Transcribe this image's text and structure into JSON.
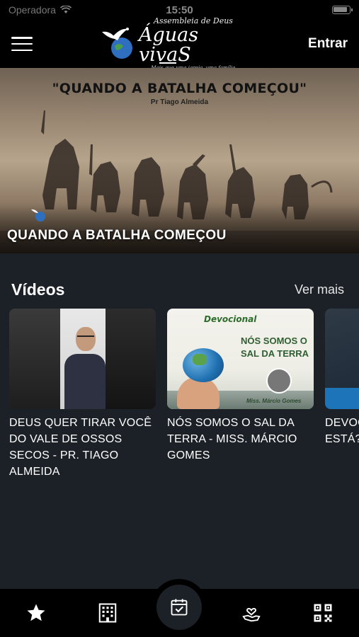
{
  "status_bar": {
    "carrier": "Operadora",
    "time": "15:50"
  },
  "header": {
    "logo": {
      "top_line": "Assembleia de Deus",
      "main": "Águas vivaS",
      "tagline": "Mais que uma igreja, uma família"
    },
    "login_label": "Entrar"
  },
  "banner": {
    "headline": "\"QUANDO A BATALHA COMEÇOU\"",
    "author": "Pr Tiago Almeida",
    "title": "QUANDO A BATALHA COMEÇOU"
  },
  "videos": {
    "section_title": "Vídeos",
    "see_more_label": "Ver mais",
    "items": [
      {
        "caption": "DEUS QUER TIRAR VOCÊ DO VALE DE OSSOS SECOS - PR. TIAGO ALMEIDA"
      },
      {
        "caption": "NÓS SOMOS O SAL DA TERRA - MISS. MÁRCIO GOMES",
        "thumb_header": "Devocional",
        "thumb_title_1": "NÓS SOMOS O",
        "thumb_title_2": "SAL DA TERRA",
        "thumb_signature": "Miss. Márcio Gomes"
      },
      {
        "caption": "DEVOCIONAL QUAL ESTÁ? ALMEIDA"
      }
    ]
  },
  "tab_bar": {
    "tabs": [
      {
        "icon": "star-icon"
      },
      {
        "icon": "building-icon"
      },
      {
        "icon": "calendar-check-icon"
      },
      {
        "icon": "hand-heart-icon"
      },
      {
        "icon": "qr-code-icon"
      }
    ]
  },
  "colors": {
    "background": "#1c2127",
    "bar": "#000000",
    "text": "#ffffff"
  }
}
